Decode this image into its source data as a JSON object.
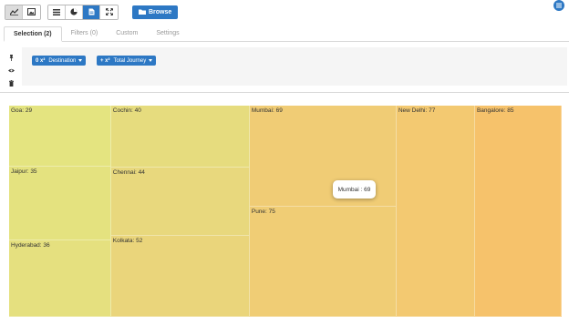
{
  "toolbar": {
    "view_buttons": [
      "line-chart-icon",
      "image-icon"
    ],
    "type_buttons": [
      "list-icon",
      "pie-icon",
      "document-icon",
      "expand-icon"
    ],
    "browse_label": "Browse"
  },
  "tabs": [
    {
      "label": "Selection (2)",
      "active": true
    },
    {
      "label": "Filters (0)",
      "active": false
    },
    {
      "label": "Custom",
      "active": false
    },
    {
      "label": "Settings",
      "active": false
    }
  ],
  "pills": [
    {
      "prefix": "0 x²",
      "label": "Destination"
    },
    {
      "prefix": "+ x²",
      "label": "Total Journey"
    }
  ],
  "tooltip": {
    "text": "Mumbai : 69"
  },
  "chart_data": {
    "type": "treemap",
    "items": [
      {
        "label": "Goa: 29",
        "name": "Goa",
        "value": 29,
        "color": "#e4e480"
      },
      {
        "label": "Jaipur: 35",
        "name": "Jaipur",
        "value": 35,
        "color": "#e4e27f"
      },
      {
        "label": "Hyderabad: 36",
        "name": "Hyderabad",
        "value": 36,
        "color": "#e5e07f"
      },
      {
        "label": "Cochin: 40",
        "name": "Cochin",
        "value": 40,
        "color": "#e6dc7e"
      },
      {
        "label": "Chennai: 44",
        "name": "Chennai",
        "value": 44,
        "color": "#e8d87d"
      },
      {
        "label": "Kolkata: 52",
        "name": "Kolkata",
        "value": 52,
        "color": "#ead57b"
      },
      {
        "label": "Mumbai: 69",
        "name": "Mumbai",
        "value": 69,
        "color": "#f0cc75"
      },
      {
        "label": "Pune: 75",
        "name": "Pune",
        "value": 75,
        "color": "#f0cd75"
      },
      {
        "label": "New Delhi: 77",
        "name": "New Delhi",
        "value": 77,
        "color": "#f3c971"
      },
      {
        "label": "Bangalore: 85",
        "name": "Bangalore",
        "value": 85,
        "color": "#f6c26b"
      }
    ]
  }
}
